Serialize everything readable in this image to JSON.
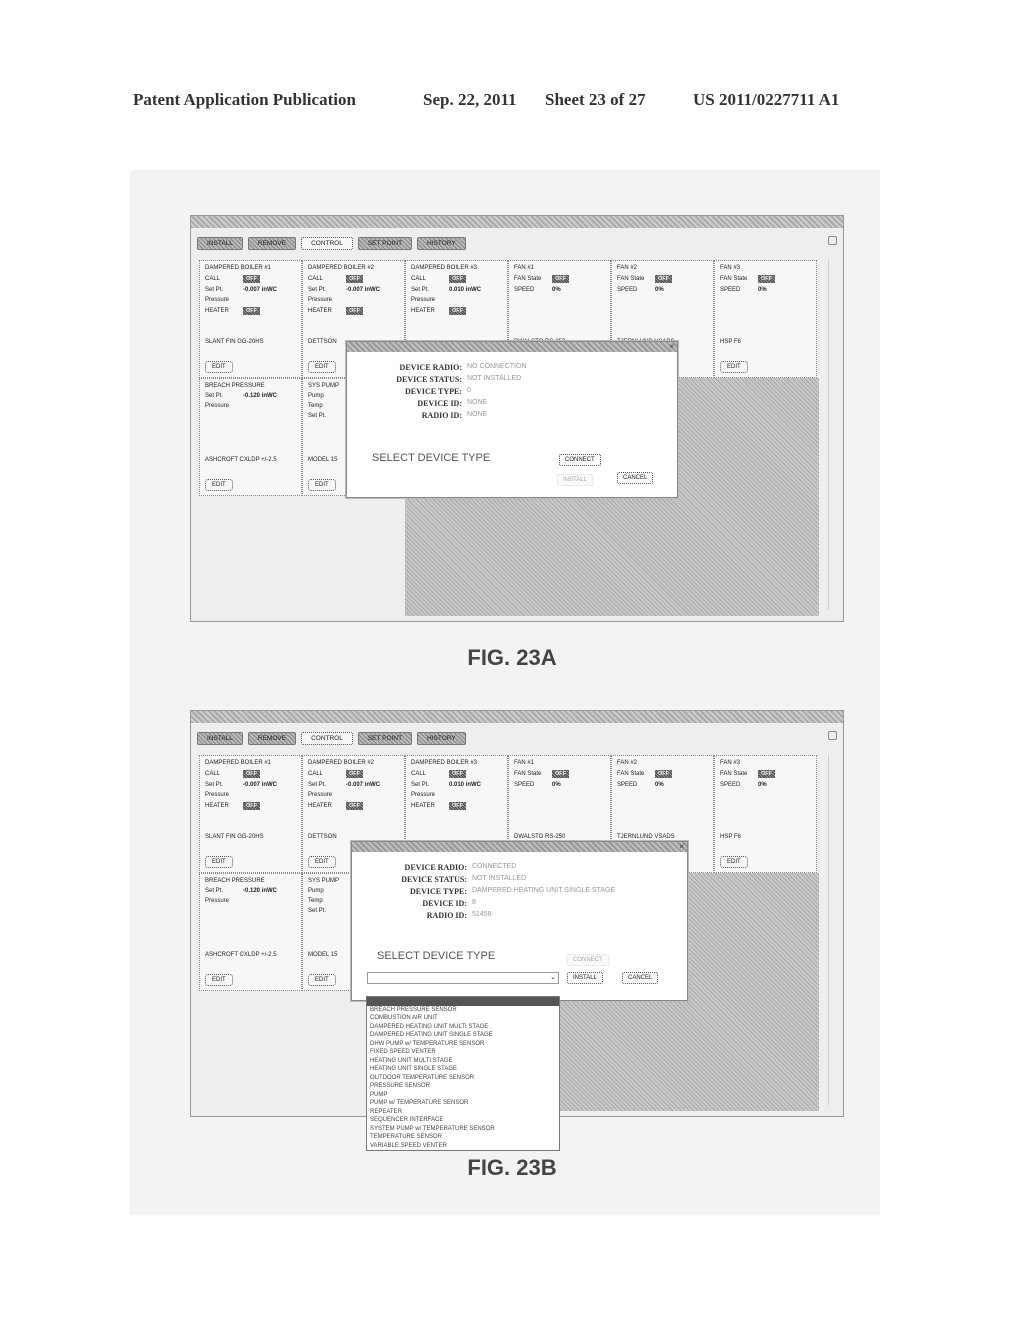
{
  "header": {
    "publication": "Patent Application Publication",
    "date": "Sep. 22, 2011",
    "sheet": "Sheet 23 of 27",
    "number": "US 2011/0227711 A1"
  },
  "toolbar": {
    "buttons": [
      "INSTALL",
      "REMOVE",
      "CONTROL",
      "SET POINT",
      "HISTORY"
    ]
  },
  "devices": [
    {
      "title": "DAMPERED BOILER #1",
      "rows": [
        [
          "CALL",
          "OFF"
        ],
        [
          "Set Pt.",
          "-0.007 inWC"
        ],
        [
          "Pressure",
          ""
        ],
        [
          "HEATER",
          "OFF"
        ]
      ],
      "model": "SLANT FIN GG-20HS",
      "edit": "EDIT"
    },
    {
      "title": "DAMPERED BOILER #2",
      "rows": [
        [
          "CALL",
          "OFF"
        ],
        [
          "Set Pt.",
          "-0.007 inWC"
        ],
        [
          "Pressure",
          ""
        ],
        [
          "HEATER",
          "OFF"
        ]
      ],
      "model": "DETTSON",
      "edit": "EDIT"
    },
    {
      "title": "DAMPERED BOILER #3",
      "rows": [
        [
          "CALL",
          "OFF"
        ],
        [
          "Set Pt.",
          "0.010 inWC"
        ],
        [
          "Pressure",
          ""
        ],
        [
          "HEATER",
          "OFF"
        ]
      ],
      "model": "",
      "edit": ""
    },
    {
      "title": "FAN #1",
      "rows": [
        [
          "FAN State",
          "OFF"
        ],
        [
          "SPEED",
          "0%"
        ]
      ],
      "model": "DWALSTO RS-250",
      "edit": ""
    },
    {
      "title": "FAN #2",
      "rows": [
        [
          "FAN State",
          "OFF"
        ],
        [
          "SPEED",
          "0%"
        ]
      ],
      "model": "TJERNLUND VSADS",
      "edit": ""
    },
    {
      "title": "FAN #3",
      "rows": [
        [
          "FAN State",
          "OFF"
        ],
        [
          "SPEED",
          "0%"
        ]
      ],
      "model": "HSP F6",
      "edit": "EDIT"
    },
    {
      "title": "BREACH PRESSURE",
      "rows": [
        [
          "Set Pt.",
          "-0.120 inWC"
        ],
        [
          "Pressure",
          ""
        ]
      ],
      "model": "ASHCROFT CXLDP +/-2.5",
      "edit": "EDIT"
    },
    {
      "title": "SYS PUMP",
      "rows": [
        [
          "Pump",
          ""
        ],
        [
          "Temp",
          ""
        ],
        [
          "Set Pt.",
          ""
        ]
      ],
      "model": "MODEL 15",
      "edit": "EDIT"
    }
  ],
  "fig_a": {
    "caption": "FIG. 23A",
    "dialog": {
      "fields": [
        {
          "label": "DEVICE RADIO:",
          "value": "NO CONNECTION"
        },
        {
          "label": "DEVICE STATUS:",
          "value": "NOT INSTALLED"
        },
        {
          "label": "DEVICE TYPE:",
          "value": "0"
        },
        {
          "label": "DEVICE ID:",
          "value": "NONE"
        },
        {
          "label": "RADIO ID:",
          "value": "NONE"
        }
      ],
      "select_label": "SELECT DEVICE TYPE",
      "connect": "CONNECT",
      "install": "INSTALL",
      "cancel": "CANCEL"
    }
  },
  "fig_b": {
    "caption": "FIG. 23B",
    "dialog": {
      "fields": [
        {
          "label": "DEVICE RADIO:",
          "value": "CONNECTED"
        },
        {
          "label": "DEVICE STATUS:",
          "value": "NOT INSTALLED"
        },
        {
          "label": "DEVICE TYPE:",
          "value": "DAMPERED HEATING UNIT SINGLE STAGE"
        },
        {
          "label": "DEVICE ID:",
          "value": "8"
        },
        {
          "label": "RADIO ID:",
          "value": "51458"
        }
      ],
      "select_label": "SELECT DEVICE TYPE",
      "connect": "CONNECT",
      "install": "INSTALL",
      "cancel": "CANCEL",
      "select_value": ""
    },
    "dropdown_options": [
      "BREACH PRESSURE SENSOR",
      "COMBUSTION AIR UNIT",
      "DAMPERED HEATING UNIT MULTI STAGE",
      "DAMPERED HEATING UNIT SINGLE STAGE",
      "DHW PUMP w/ TEMPERATURE SENSOR",
      "FIXED SPEED VENTER",
      "HEATING UNIT MULTI STAGE",
      "HEATING UNIT SINGLE STAGE",
      "OUTDOOR TEMPERATURE SENSOR",
      "PRESSURE SENSOR",
      "PUMP",
      "PUMP w/ TEMPERATURE SENSOR",
      "REPEATER",
      "SEQUENCER INTERFACE",
      "SYSTEM PUMP w/ TEMPERATURE SENSOR",
      "TEMPERATURE SENSOR",
      "VARIABLE SPEED VENTER"
    ]
  }
}
